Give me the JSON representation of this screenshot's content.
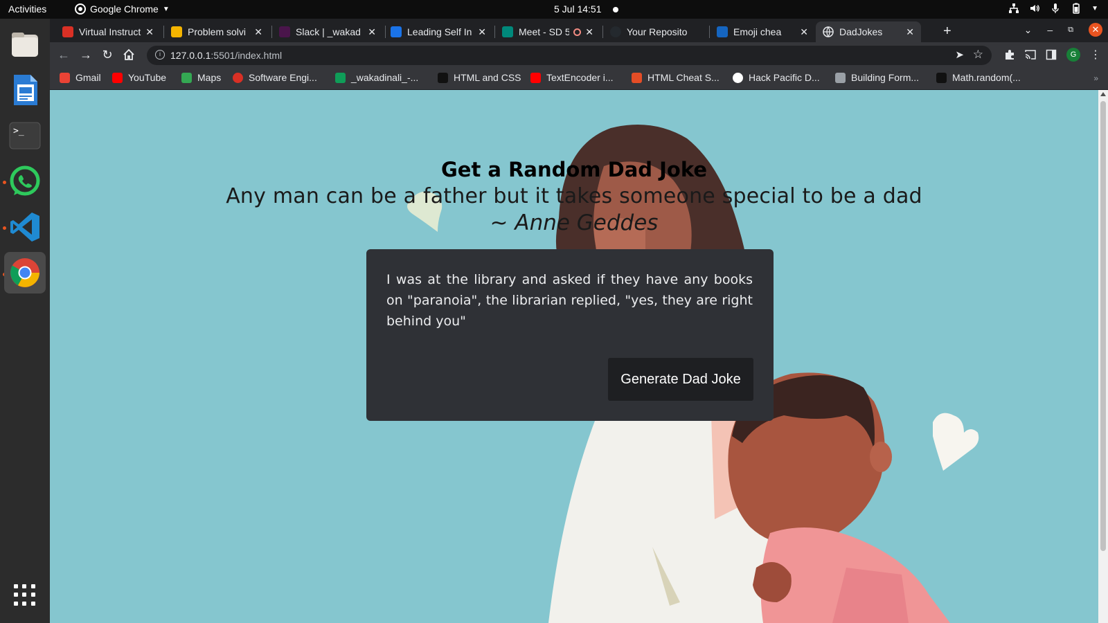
{
  "system": {
    "activities_label": "Activities",
    "app_name": "Google Chrome",
    "clock": "5 Jul  14:51"
  },
  "tabs": [
    {
      "title": "Virtual Instruct",
      "favicon_color": "#d93025"
    },
    {
      "title": "Problem solvi",
      "favicon_color": "#f4b400"
    },
    {
      "title": "Slack | _wakad",
      "favicon_color": "#4a154b"
    },
    {
      "title": "Leading Self In",
      "favicon_color": "#1a73e8"
    },
    {
      "title": "Meet - SD 5",
      "favicon_color": "#00897b"
    },
    {
      "title": "Your Reposito",
      "favicon_color": "#24292e"
    },
    {
      "title": "Emoji chea",
      "favicon_color": "#1565c0"
    },
    {
      "title": "DadJokes",
      "favicon_color": "#9aa0a6",
      "active": true
    }
  ],
  "address_bar": {
    "url_host": "127.0.0.1",
    "url_rest": ":5501/index.html"
  },
  "bookmarks": [
    {
      "label": "Gmail",
      "color": "#ea4335"
    },
    {
      "label": "YouTube",
      "color": "#ff0000"
    },
    {
      "label": "Maps",
      "color": "#34a853"
    },
    {
      "label": "Software Engi...",
      "color": "#d93025"
    },
    {
      "label": "_wakadinali_-...",
      "color": "#0f9d58"
    },
    {
      "label": "HTML and CSS",
      "color": "#111111"
    },
    {
      "label": "TextEncoder i...",
      "color": "#ff0000"
    },
    {
      "label": "HTML Cheat S...",
      "color": "#e44d26"
    },
    {
      "label": "Hack Pacific D...",
      "color": "#ffffff"
    },
    {
      "label": "Building Form...",
      "color": "#9aa0a6"
    },
    {
      "label": "Math.random(...",
      "color": "#111111"
    }
  ],
  "page": {
    "heading": "Get a Random Dad Joke",
    "quote": "Any man can be a father but it takes someone special to be a dad",
    "author": "~ Anne Geddes",
    "joke": "I was at the library and asked if they have any books on \"paranoia\", the librarian replied, \"yes, they are right behind you\"",
    "button_label": "Generate Dad Joke"
  },
  "profile_initial": "G",
  "colors": {
    "page_background": "#85c6cf",
    "card_background": "#2f3136",
    "button_background": "#1e1f22"
  }
}
